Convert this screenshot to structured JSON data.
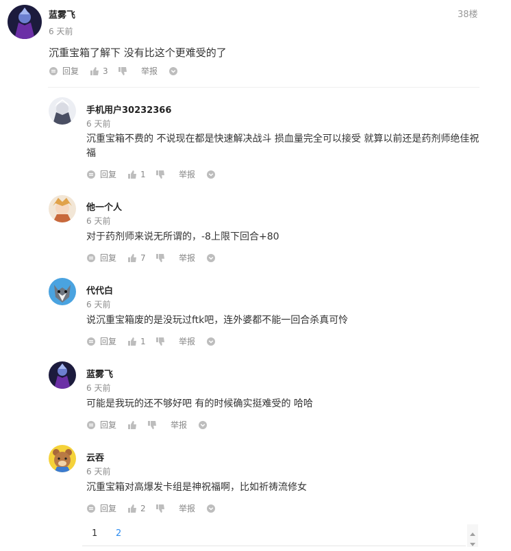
{
  "main": {
    "author": "蓝雾飞",
    "time": "6 天前",
    "floor": "38楼",
    "content": "沉重宝箱了解下  没有比这个更难受的了",
    "reply_label": "回复",
    "like_count": "3",
    "report_label": "举报"
  },
  "replies": [
    {
      "author": "手机用户30232366",
      "time": "6 天前",
      "content": "沉重宝箱不费的 不说现在都是快速解决战斗 损血量完全可以接受 就算以前还是药剂师绝佳祝福",
      "reply_label": "回复",
      "like_count": "1",
      "report_label": "举报"
    },
    {
      "author": "他一个人",
      "time": "6 天前",
      "content": "对于药剂师来说无所谓的，-8上限下回合+80",
      "reply_label": "回复",
      "like_count": "7",
      "report_label": "举报"
    },
    {
      "author": "代代白",
      "time": "6 天前",
      "content": "说沉重宝箱废的是没玩过ftk吧，连外婆都不能一回合杀真可怜",
      "reply_label": "回复",
      "like_count": "1",
      "report_label": "举报"
    },
    {
      "author": "蓝雾飞",
      "time": "6 天前",
      "content": "可能是我玩的还不够好吧 有的时候确实挺难受的 哈哈",
      "reply_label": "回复",
      "like_count": "",
      "report_label": "举报"
    },
    {
      "author": "云吞",
      "time": "6 天前",
      "content": "沉重宝箱对高爆发卡组是神祝福啊，比如祈祷流修女",
      "reply_label": "回复",
      "like_count": "2",
      "report_label": "举报"
    }
  ],
  "pagination": {
    "pages": [
      "1",
      "2"
    ],
    "current": "1"
  },
  "colors": {
    "link": "#2d8cf0",
    "muted": "#888888",
    "divider": "#eeeeee"
  }
}
